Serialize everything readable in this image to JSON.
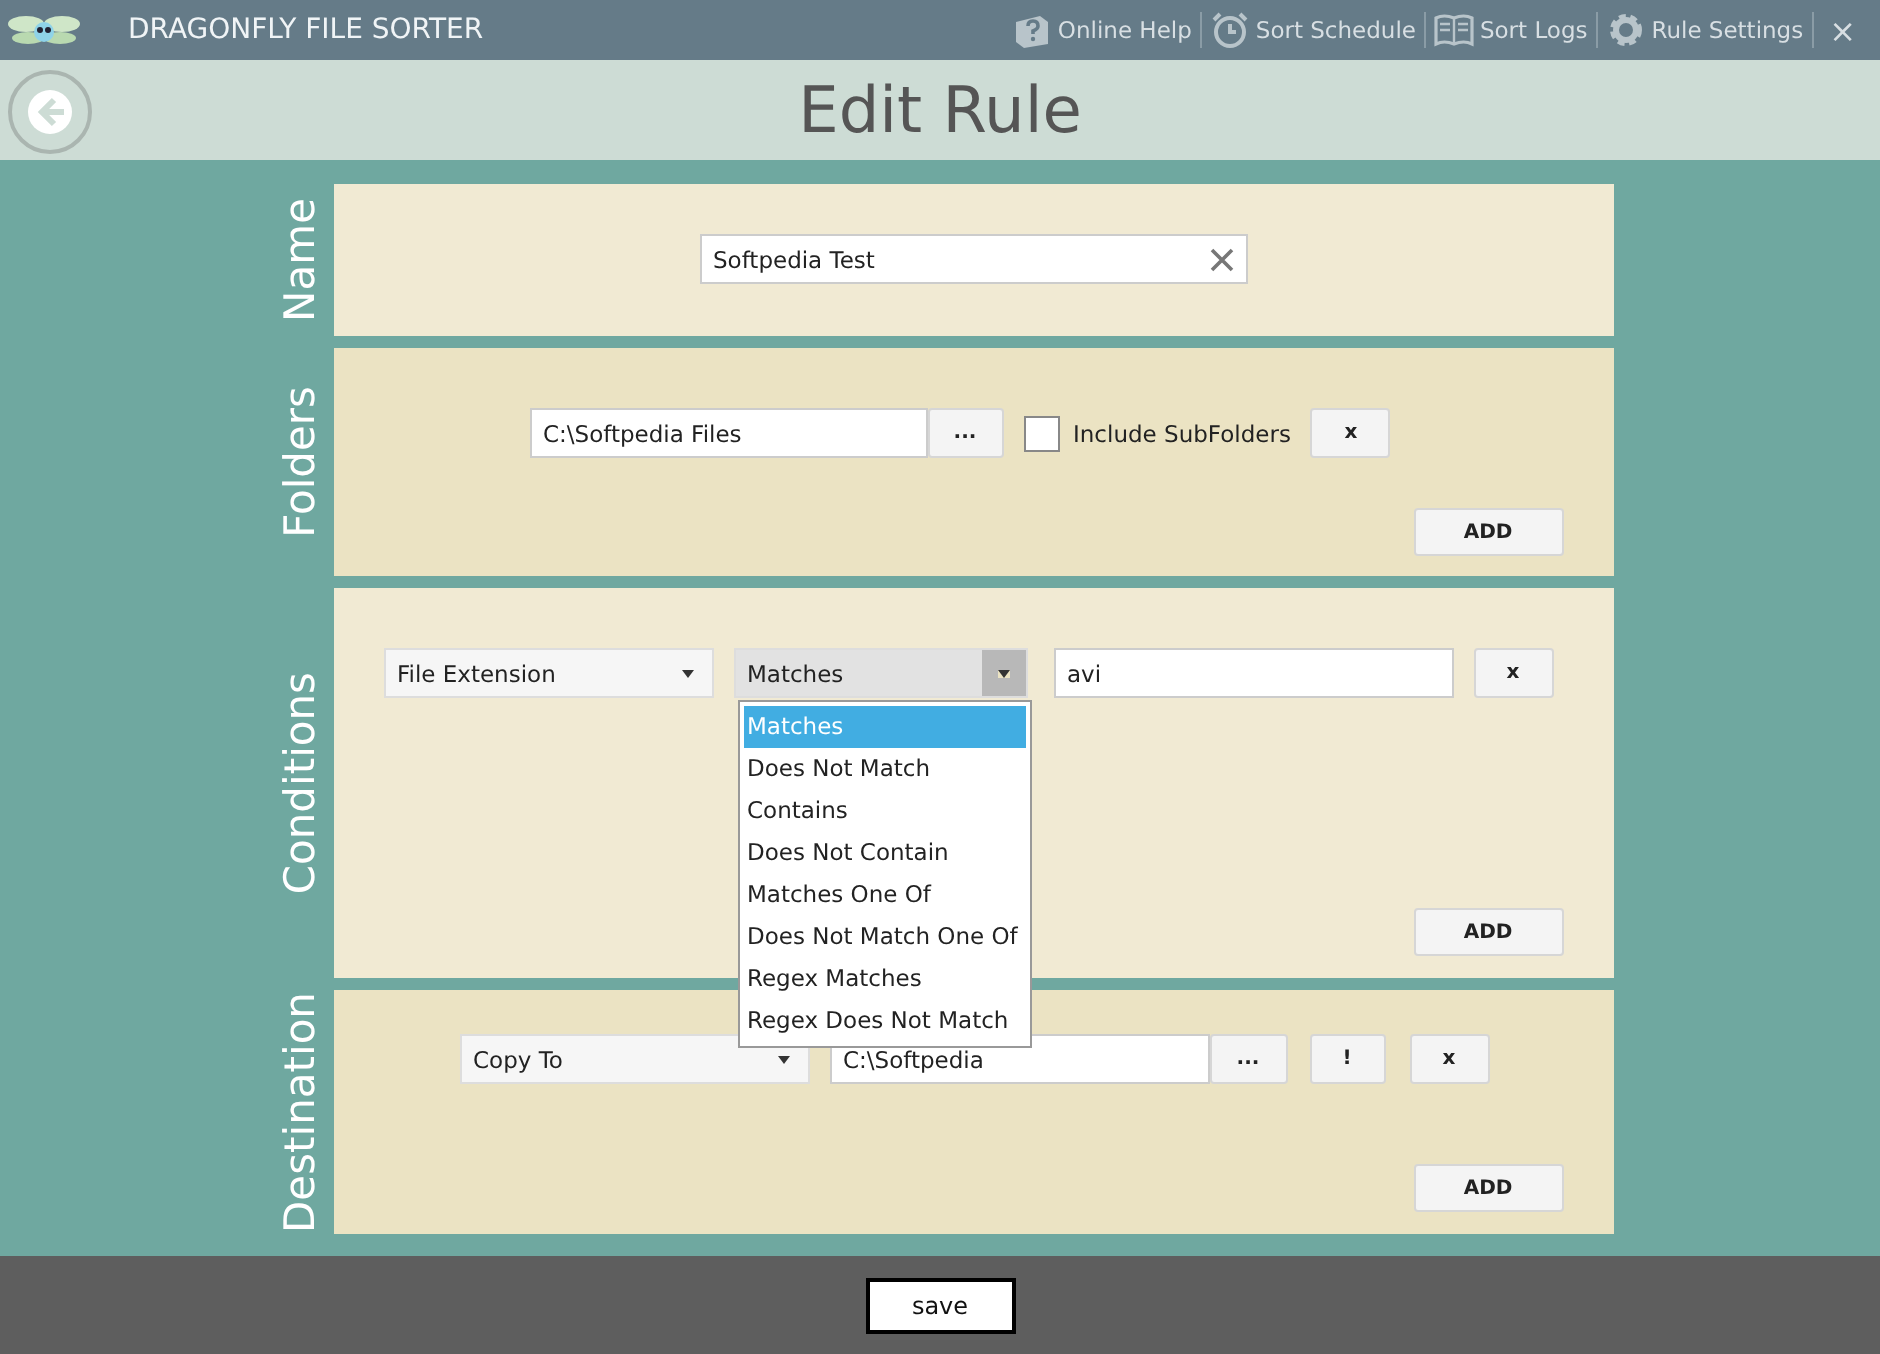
{
  "app": {
    "title": "DRAGONFLY FILE SORTER",
    "nav": [
      {
        "label": "Online Help",
        "kind": "help"
      },
      {
        "label": "Sort Schedule",
        "kind": "schedule"
      },
      {
        "label": "Sort Logs",
        "kind": "logs"
      },
      {
        "label": "Rule Settings",
        "kind": "settings"
      }
    ],
    "close": "×"
  },
  "page": {
    "title": "Edit Rule"
  },
  "name_section": {
    "label": "Name",
    "value": "Softpedia Test"
  },
  "folders_section": {
    "label": "Folders",
    "path": "C:\\Softpedia Files",
    "browse": "...",
    "include_subfolders": {
      "label": "Include SubFolders",
      "checked": false
    },
    "remove": "x",
    "add": "ADD"
  },
  "conditions_section": {
    "label": "Conditions",
    "field": "File Extension",
    "operator": "Matches",
    "value": "avi",
    "remove": "x",
    "add": "ADD",
    "operator_menu": [
      {
        "label": "Matches",
        "selected": true
      },
      {
        "label": "Does Not Match",
        "selected": false
      },
      {
        "label": "Contains",
        "selected": false
      },
      {
        "label": "Does Not Contain",
        "selected": false
      },
      {
        "label": "Matches One Of",
        "selected": false
      },
      {
        "label": "Does Not Match One Of",
        "selected": false
      },
      {
        "label": "Regex Matches",
        "selected": false
      },
      {
        "label": "Regex Does Not Match",
        "selected": false
      }
    ]
  },
  "destination_section": {
    "label": "Destination",
    "action": "Copy To",
    "path": "C:\\Softpedia",
    "browse": "...",
    "test": "!",
    "remove": "x",
    "add": "ADD"
  },
  "footer": {
    "save": "save"
  }
}
